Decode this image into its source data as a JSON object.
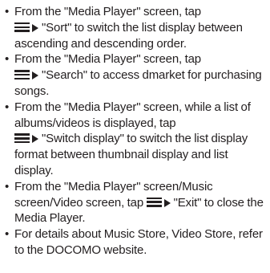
{
  "bullets": [
    {
      "before_icon": "From the \"Media Player\" screen, tap",
      "after_icon": "\"Sort\" to switch the list display between ascending and descending order."
    },
    {
      "before_icon": "From the \"Media Player\" screen, tap",
      "after_icon": "\"Search\" to access dmarket for purchasing songs."
    },
    {
      "before_icon": "From the \"Media Player\" screen, while a list of albums/videos is displayed, tap",
      "after_icon": "\"Switch display\" to switch the list display format between thumbnail display and list display."
    },
    {
      "before_icon": "From the \"Media Player\" screen/Music screen/Video screen, tap",
      "after_icon": "\"Exit\" to close the Media Player."
    },
    {
      "text": "For details about Music Store, Video Store, refer to the DOCOMO website."
    }
  ],
  "bullet_symbol": "•",
  "icons": {
    "menu": "menu-icon",
    "arrow": "arrow-right-icon"
  }
}
